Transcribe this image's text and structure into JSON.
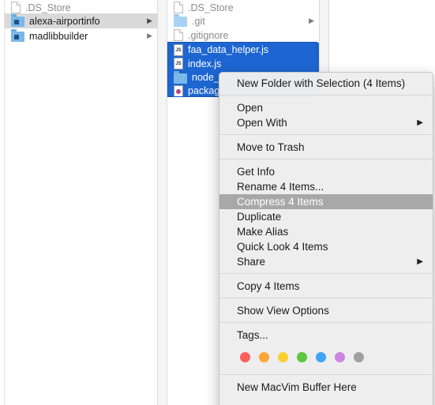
{
  "column1": {
    "items": [
      {
        "name": ".DS_Store",
        "kind": "file",
        "state": "dim"
      },
      {
        "name": "alexa-airportinfo",
        "kind": "folder",
        "state": "selected-gray",
        "has_arrow": true
      },
      {
        "name": "madlibbuilder",
        "kind": "folder",
        "state": "normal",
        "has_arrow": true
      }
    ]
  },
  "column2": {
    "items": [
      {
        "name": ".DS_Store",
        "kind": "file",
        "state": "dim"
      },
      {
        "name": ".git",
        "kind": "folder",
        "state": "dim",
        "has_arrow": true
      },
      {
        "name": ".gitignore",
        "kind": "file",
        "state": "dim"
      },
      {
        "name": "faa_data_helper.js",
        "kind": "js",
        "state": "selected-blue"
      },
      {
        "name": "index.js",
        "kind": "js",
        "state": "selected-blue"
      },
      {
        "name": "node_m",
        "kind": "folder",
        "state": "selected-blue"
      },
      {
        "name": "packag",
        "kind": "package",
        "state": "selected-blue"
      }
    ]
  },
  "context_menu": {
    "new_folder_with_selection": "New Folder with Selection (4 Items)",
    "open": "Open",
    "open_with": "Open With",
    "move_to_trash": "Move to Trash",
    "get_info": "Get Info",
    "rename": "Rename 4 Items...",
    "compress": "Compress 4 Items",
    "duplicate": "Duplicate",
    "make_alias": "Make Alias",
    "quick_look": "Quick Look 4 Items",
    "share": "Share",
    "copy": "Copy 4 Items",
    "show_view_options": "Show View Options",
    "tags": "Tags...",
    "new_macvim_buffer": "New MacVim Buffer Here",
    "highlighted_item": "Compress 4 Items"
  },
  "tag_colors": [
    {
      "name": "red",
      "color": "#fc605c"
    },
    {
      "name": "orange",
      "color": "#fda535"
    },
    {
      "name": "yellow",
      "color": "#fbcf2f"
    },
    {
      "name": "green",
      "color": "#5bc83f"
    },
    {
      "name": "blue",
      "color": "#3ea4f4"
    },
    {
      "name": "purple",
      "color": "#cd85e1"
    },
    {
      "name": "gray",
      "color": "#a0a0a0"
    }
  ],
  "icons": {
    "arrow": "▶",
    "submenu_arrow": "▶",
    "js_label": "JS"
  }
}
